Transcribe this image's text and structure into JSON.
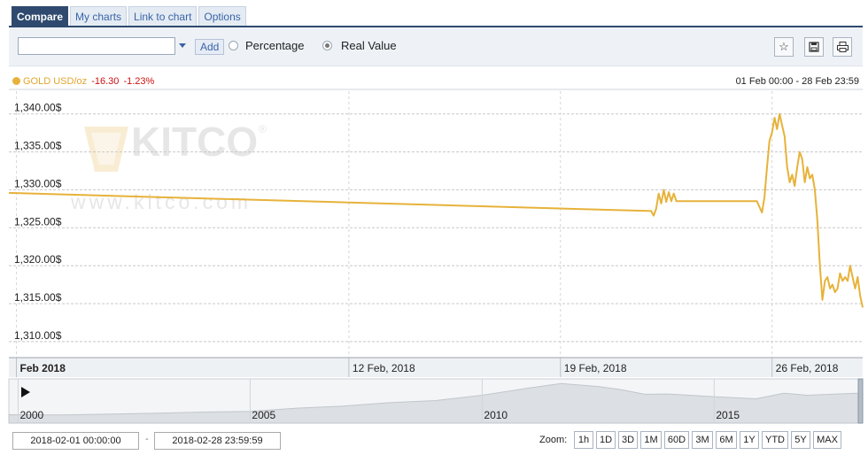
{
  "tabs": [
    "Compare",
    "My charts",
    "Link to chart",
    "Options"
  ],
  "toolbar": {
    "symbol_value": "",
    "add_label": "Add",
    "percentage_label": "Percentage",
    "real_value_label": "Real Value",
    "selected_mode": "Real Value"
  },
  "legend": {
    "name": "GOLD USD/oz",
    "change": "-16.30",
    "change_pct": "-1.23%",
    "color": "#e7b23a",
    "date_range": "01 Feb 00:00 - 28 Feb 23:59"
  },
  "watermark": {
    "brand": "KITCO",
    "site": "www.kitco.com"
  },
  "chart_data": {
    "type": "line",
    "ylim": [
      1308,
      1343
    ],
    "yticks": [
      "1,340.00$",
      "1,335.00$",
      "1,330.00$",
      "1,325.00$",
      "1,320.00$",
      "1,315.00$",
      "1,310.00$"
    ],
    "ytick_values": [
      1340,
      1335,
      1330,
      1325,
      1320,
      1315,
      1310
    ],
    "xlim": [
      "2018-01-31 18:00",
      "2018-02-28 23:59"
    ],
    "xticks": [
      {
        "label": "Feb 2018",
        "date": "2018-02-01 00:00",
        "bold": true
      },
      {
        "label": "12 Feb, 2018",
        "date": "2018-02-12 00:00",
        "bold": false
      },
      {
        "label": "19 Feb, 2018",
        "date": "2018-02-19 00:00",
        "bold": false
      },
      {
        "label": "26 Feb, 2018",
        "date": "2018-02-26 00:00",
        "bold": false
      }
    ],
    "series": [
      {
        "color": "#e7b23a",
        "x": [
          "2018-01-31 18:00",
          "2018-02-22 00:00",
          "2018-02-22 02:00",
          "2018-02-22 04:00",
          "2018-02-22 06:00",
          "2018-02-22 08:00",
          "2018-02-22 10:00",
          "2018-02-22 12:00",
          "2018-02-22 14:00",
          "2018-02-22 16:00",
          "2018-02-22 18:00",
          "2018-02-22 20:00",
          "2018-02-23 00:00",
          "2018-02-23 06:00",
          "2018-02-23 12:00",
          "2018-02-24 12:00",
          "2018-02-25 12:00",
          "2018-02-25 16:00",
          "2018-02-25 18:00",
          "2018-02-25 20:00",
          "2018-02-25 22:00",
          "2018-02-26 00:00",
          "2018-02-26 02:00",
          "2018-02-26 04:00",
          "2018-02-26 06:00",
          "2018-02-26 08:00",
          "2018-02-26 10:00",
          "2018-02-26 12:00",
          "2018-02-26 14:00",
          "2018-02-26 16:00",
          "2018-02-26 18:00",
          "2018-02-26 20:00",
          "2018-02-26 22:00",
          "2018-02-27 00:00",
          "2018-02-27 02:00",
          "2018-02-27 04:00",
          "2018-02-27 06:00",
          "2018-02-27 08:00",
          "2018-02-27 10:00",
          "2018-02-27 12:00",
          "2018-02-27 14:00",
          "2018-02-27 16:00",
          "2018-02-27 18:00",
          "2018-02-27 20:00",
          "2018-02-27 22:00",
          "2018-02-28 00:00",
          "2018-02-28 02:00",
          "2018-02-28 04:00",
          "2018-02-28 06:00",
          "2018-02-28 08:00",
          "2018-02-28 10:00",
          "2018-02-28 12:00",
          "2018-02-28 14:00",
          "2018-02-28 16:00",
          "2018-02-28 18:00",
          "2018-02-28 20:00",
          "2018-02-28 22:00",
          "2018-02-28 23:59"
        ],
        "values": [
          1329.6,
          1327.2,
          1326.6,
          1327.5,
          1329.5,
          1328.2,
          1330.0,
          1328.4,
          1329.7,
          1328.5,
          1329.5,
          1328.5,
          1328.5,
          1328.5,
          1328.5,
          1328.5,
          1328.5,
          1327.0,
          1329.0,
          1333.0,
          1336.5,
          1337.5,
          1339.5,
          1338.0,
          1340.0,
          1338.5,
          1337.0,
          1333.0,
          1331.0,
          1332.0,
          1330.5,
          1333.0,
          1335.0,
          1334.0,
          1331.0,
          1333.0,
          1331.5,
          1332.0,
          1330.0,
          1326.0,
          1320.0,
          1315.5,
          1318.0,
          1318.5,
          1317.0,
          1317.5,
          1316.5,
          1317.0,
          1319.0,
          1318.0,
          1318.5,
          1318.0,
          1320.0,
          1318.5,
          1317.0,
          1318.5,
          1316.0,
          1314.5
        ]
      }
    ]
  },
  "navigator": {
    "year_labels": [
      "2000",
      "2005",
      "2010",
      "2015"
    ],
    "year_values": [
      2000,
      2005,
      2010,
      2015
    ],
    "range": [
      1999.8,
      2018.2
    ],
    "play_icon": "play-icon",
    "overview_x": [
      1999.8,
      2001.0,
      2002.0,
      2003.0,
      2004.0,
      2005.0,
      2006.0,
      2007.0,
      2008.0,
      2009.0,
      2010.0,
      2011.0,
      2011.7,
      2012.5,
      2013.0,
      2013.5,
      2014.0,
      2015.0,
      2015.9,
      2016.5,
      2017.0,
      2018.0,
      2018.2
    ],
    "overview_y": [
      280,
      270,
      310,
      360,
      410,
      440,
      600,
      700,
      870,
      970,
      1230,
      1580,
      1800,
      1660,
      1500,
      1280,
      1290,
      1160,
      1060,
      1330,
      1230,
      1320,
      1330
    ]
  },
  "range_inputs": {
    "start": "2018-02-01 00:00:00",
    "end": "2018-02-28 23:59:59"
  },
  "zoom": {
    "label": "Zoom:",
    "buttons": [
      "1h",
      "1D",
      "3D",
      "1M",
      "60D",
      "3M",
      "6M",
      "1Y",
      "YTD",
      "5Y",
      "MAX"
    ]
  },
  "icons": {
    "favorite": "star-icon",
    "save": "save-icon",
    "print": "print-icon"
  }
}
